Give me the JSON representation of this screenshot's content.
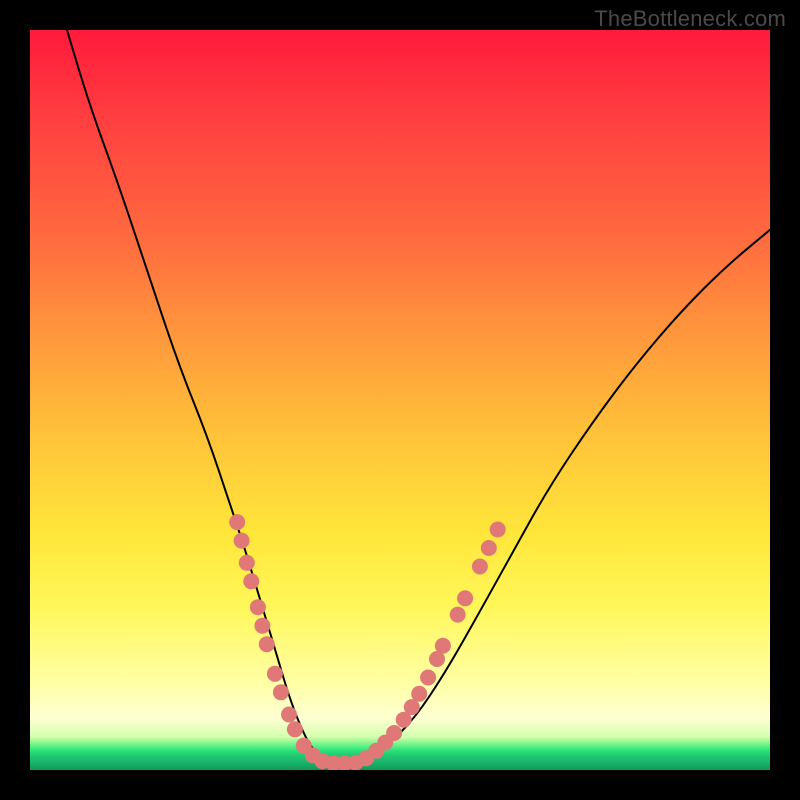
{
  "watermark": "TheBottleneck.com",
  "colors": {
    "frame": "#000000",
    "gradient_top": "#ff1a3c",
    "gradient_mid": "#ffe63a",
    "gradient_bottom": "#0f9a59",
    "curve": "#000000",
    "dots": "#e07878"
  },
  "chart_data": {
    "type": "line",
    "title": "",
    "xlabel": "",
    "ylabel": "",
    "xlim": [
      0,
      100
    ],
    "ylim": [
      0,
      100
    ],
    "grid": false,
    "legend": false,
    "series": [
      {
        "name": "bottleneck-curve",
        "x": [
          5,
          8,
          12,
          16,
          20,
          24,
          27,
          29,
          30.5,
          32,
          33.5,
          35,
          36.5,
          38,
          40,
          44,
          48,
          52,
          56,
          60,
          65,
          70,
          76,
          82,
          88,
          94,
          100
        ],
        "y": [
          100,
          90,
          79,
          67,
          55,
          45,
          36,
          30,
          25,
          20,
          15,
          10,
          6,
          3,
          1,
          1,
          3,
          7,
          13,
          20,
          29,
          38,
          47,
          55,
          62,
          68,
          73
        ]
      }
    ],
    "markers": [
      {
        "x": 28.0,
        "y": 33.5
      },
      {
        "x": 28.6,
        "y": 31.0
      },
      {
        "x": 29.3,
        "y": 28.0
      },
      {
        "x": 29.9,
        "y": 25.5
      },
      {
        "x": 30.8,
        "y": 22.0
      },
      {
        "x": 31.4,
        "y": 19.5
      },
      {
        "x": 32.0,
        "y": 17.0
      },
      {
        "x": 33.1,
        "y": 13.0
      },
      {
        "x": 33.9,
        "y": 10.5
      },
      {
        "x": 35.0,
        "y": 7.5
      },
      {
        "x": 35.8,
        "y": 5.5
      },
      {
        "x": 37.0,
        "y": 3.3
      },
      {
        "x": 38.2,
        "y": 2.0
      },
      {
        "x": 39.5,
        "y": 1.2
      },
      {
        "x": 41.0,
        "y": 0.9
      },
      {
        "x": 42.5,
        "y": 0.9
      },
      {
        "x": 44.0,
        "y": 1.0
      },
      {
        "x": 45.4,
        "y": 1.6
      },
      {
        "x": 46.8,
        "y": 2.6
      },
      {
        "x": 48.0,
        "y": 3.7
      },
      {
        "x": 49.2,
        "y": 5.0
      },
      {
        "x": 50.5,
        "y": 6.8
      },
      {
        "x": 51.6,
        "y": 8.5
      },
      {
        "x": 52.6,
        "y": 10.3
      },
      {
        "x": 53.8,
        "y": 12.5
      },
      {
        "x": 55.0,
        "y": 15.0
      },
      {
        "x": 55.8,
        "y": 16.8
      },
      {
        "x": 57.8,
        "y": 21.0
      },
      {
        "x": 58.8,
        "y": 23.2
      },
      {
        "x": 60.8,
        "y": 27.5
      },
      {
        "x": 62.0,
        "y": 30.0
      },
      {
        "x": 63.2,
        "y": 32.5
      }
    ]
  }
}
